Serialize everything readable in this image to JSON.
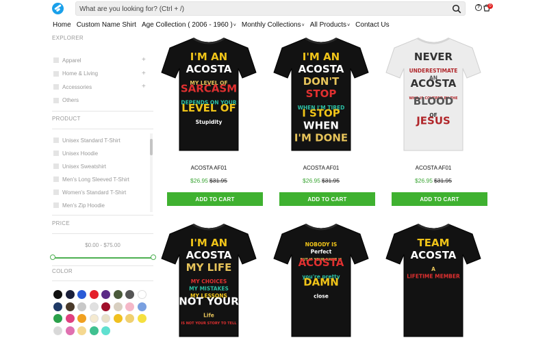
{
  "header": {
    "search_placeholder": "What are you looking for? (Ctrl + /)",
    "help_glyph": "?",
    "cart_count": "0"
  },
  "nav": [
    {
      "label": "Home",
      "has_dropdown": false
    },
    {
      "label": "Custom Name Shirt",
      "has_dropdown": false
    },
    {
      "label": "Age Collection ( 2006 - 1960 )",
      "has_dropdown": true
    },
    {
      "label": "Monthly Collections",
      "has_dropdown": true
    },
    {
      "label": "All Products",
      "has_dropdown": true
    },
    {
      "label": "Contact Us",
      "has_dropdown": false
    }
  ],
  "sidebar": {
    "explorer_title": "EXPLORER",
    "explorer_items": [
      {
        "label": "Apparel",
        "expandable": true
      },
      {
        "label": "Home & Living",
        "expandable": true
      },
      {
        "label": "Accessories",
        "expandable": true
      },
      {
        "label": "Others",
        "expandable": false
      }
    ],
    "product_title": "PRODUCT",
    "product_items": [
      "Unisex Standard T-Shirt",
      "Unisex Hoodie",
      "Unisex Sweatshirt",
      "Men's Long Sleeved T-Shirt",
      "Women's Standard T-Shirt",
      "Men's Zip Hoodie"
    ],
    "price_title": "PRICE",
    "price_range": "$0.00 - $75.00",
    "color_title": "COLOR",
    "colors": [
      "#111111",
      "#1a1f3a",
      "#2a5bd7",
      "#e4202a",
      "#5b2a86",
      "#4a5a3a",
      "#555555",
      "#ffffff",
      "#1f3a66",
      "#4a3a2a",
      "#c8c8c8",
      "#e0e0e0",
      "#a00f2a",
      "#d8cfc0",
      "#f5b8c8",
      "#7aa0e0",
      "#2aa04a",
      "#e04080",
      "#f0a020",
      "#f5ead0",
      "#e8e0c8",
      "#f0c020",
      "#f0d070",
      "#f5e040",
      "#d8d8d8",
      "#e070b0",
      "#f5d890",
      "#40c090",
      "#60e0d0"
    ]
  },
  "products": [
    {
      "name": "ACOSTA AF01",
      "price": "$26.95",
      "old_price": "$31.95",
      "button": "ADD TO CART",
      "shirt_color": "#121212",
      "lines": [
        "I'M AN",
        "ACOSTA",
        "MY LEVEL OF",
        "SARCASM",
        "DEPENDS ON YOUR",
        "LEVEL OF",
        "Stupidity"
      ]
    },
    {
      "name": "ACOSTA AF01",
      "price": "$26.95",
      "old_price": "$31.95",
      "button": "ADD TO CART",
      "shirt_color": "#121212",
      "lines": [
        "I'M AN",
        "ACOSTA",
        "DON'T",
        "STOP",
        "WHEN I'M TIRED",
        "I STOP",
        "WHEN",
        "I'M DONE"
      ]
    },
    {
      "name": "ACOSTA AF01",
      "price": "$26.95",
      "old_price": "$31.95",
      "button": "ADD TO CART",
      "shirt_color": "#ececec",
      "lines": [
        "NEVER",
        "UNDERESTIMATE",
        "AN",
        "ACOSTA",
        "WHO IS COVERED BY THE",
        "BLOOD",
        "OF",
        "JESUS"
      ]
    },
    {
      "name": "",
      "price": "",
      "old_price": "",
      "button": "",
      "shirt_color": "#121212",
      "lines": [
        "I'M AN",
        "ACOSTA",
        "MY LIFE",
        "MY CHOICES",
        "MY MISTAKES",
        "MY LESSONS",
        "NOT YOUR",
        "Life",
        "IS NOT YOUR STORY TO TELL"
      ]
    },
    {
      "name": "",
      "price": "",
      "old_price": "",
      "button": "",
      "shirt_color": "#121212",
      "lines": [
        "NOBODY IS",
        "Perfect",
        "BUT IF YOUR NAME IS",
        "ACOSTA",
        "you're pretty",
        "DAMN",
        "close"
      ]
    },
    {
      "name": "",
      "price": "",
      "old_price": "",
      "button": "",
      "shirt_color": "#121212",
      "lines": [
        "TEAM",
        "ACOSTA",
        "A",
        "LIFETIME MEMBER"
      ]
    }
  ]
}
